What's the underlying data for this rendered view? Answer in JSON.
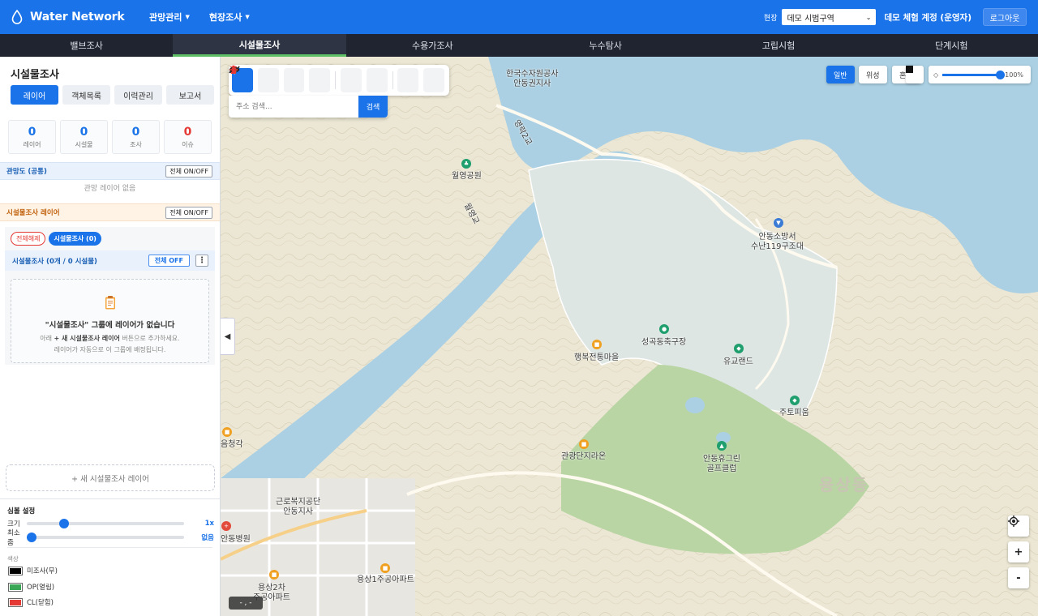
{
  "header": {
    "app_title": "Water Network",
    "menus": [
      {
        "label": "관망관리"
      },
      {
        "label": "현장조사"
      }
    ],
    "site_label": "현장",
    "site_value": "데모 시범구역",
    "user": "데모 체험 계정 (운영자)",
    "logout_label": "로그아웃",
    "accent": "#1a73e8"
  },
  "tabs": [
    {
      "label": "밸브조사",
      "active": false
    },
    {
      "label": "시설물조사",
      "active": true
    },
    {
      "label": "수용가조사",
      "active": false
    },
    {
      "label": "누수탐사",
      "active": false
    },
    {
      "label": "고립시험",
      "active": false
    },
    {
      "label": "단계시험",
      "active": false
    }
  ],
  "sidebar": {
    "title": "시설물조사",
    "subtabs": [
      "레이어",
      "객체목록",
      "이력관리",
      "보고서"
    ],
    "stats": [
      {
        "value": "0",
        "label": "레이어"
      },
      {
        "value": "0",
        "label": "시설물"
      },
      {
        "value": "0",
        "label": "조사"
      },
      {
        "value": "0",
        "label": "이슈"
      }
    ],
    "network_section": {
      "title": "관망도 (공통)",
      "toggle": "전체 ON/OFF",
      "empty": "관망 레이어 없음"
    },
    "survey_section": {
      "title": "시설물조사 레이어",
      "toggle": "전체 ON/OFF"
    },
    "chips": {
      "clear": "전체해제",
      "group": "시설물조사 (0)"
    },
    "group": {
      "title": "시설물조사 (0개 / 0 시설물)",
      "off": "전체 OFF",
      "more": "⋮"
    },
    "empty_box": {
      "title": "\"시설물조사\" 그룹에 레이어가 없습니다",
      "line1_pre": "아래 ",
      "line1_bold": "+ 새 시설물조사 레이어",
      "line1_post": " 버튼으로 추가하세요.",
      "line2": "레이어가 자동으로 이 그룹에 배정됩니다."
    },
    "new_layer": "+ 새 시설물조사 레이어",
    "symbol": {
      "title": "심볼 설정",
      "size_label": "크기",
      "size_value": "1x",
      "size_level": 0.22,
      "minzoom_label": "최소줌",
      "minzoom_value": "없음",
      "minzoom_level": 0.0,
      "color_title": "색상",
      "legend": [
        {
          "label": "미조사(무)",
          "color": "#000000"
        },
        {
          "label": "OP(열림)",
          "color": "#3aa757"
        },
        {
          "label": "CL(닫힘)",
          "color": "#e53935"
        }
      ]
    }
  },
  "map": {
    "search_placeholder": "주소 검색...",
    "search_button": "검색",
    "types": [
      "일반",
      "위성",
      "혼합"
    ],
    "active_type": "일반",
    "opacity_value": "100%",
    "coord": "- , -",
    "labels": [
      "한국수자원공사\n안동권지사",
      "영락2교",
      "월영공원",
      "월영교",
      "안동소방서\n수난119구조대",
      "성곡동축구장",
      "유교랜드",
      "행복전통마을",
      "주토피움",
      "관광단지라온",
      "안동휴그린\n골프클럽",
      "용상동",
      "근로복지공단\n안동지사",
      "안동병원",
      "용상1주공아파트",
      "용상2차\n주공아파트",
      "음청각"
    ],
    "colors": {
      "land": "#ece7d4",
      "water": "#abd0e3",
      "park": "#b9d5a4",
      "zone": "#dde6e2"
    }
  }
}
